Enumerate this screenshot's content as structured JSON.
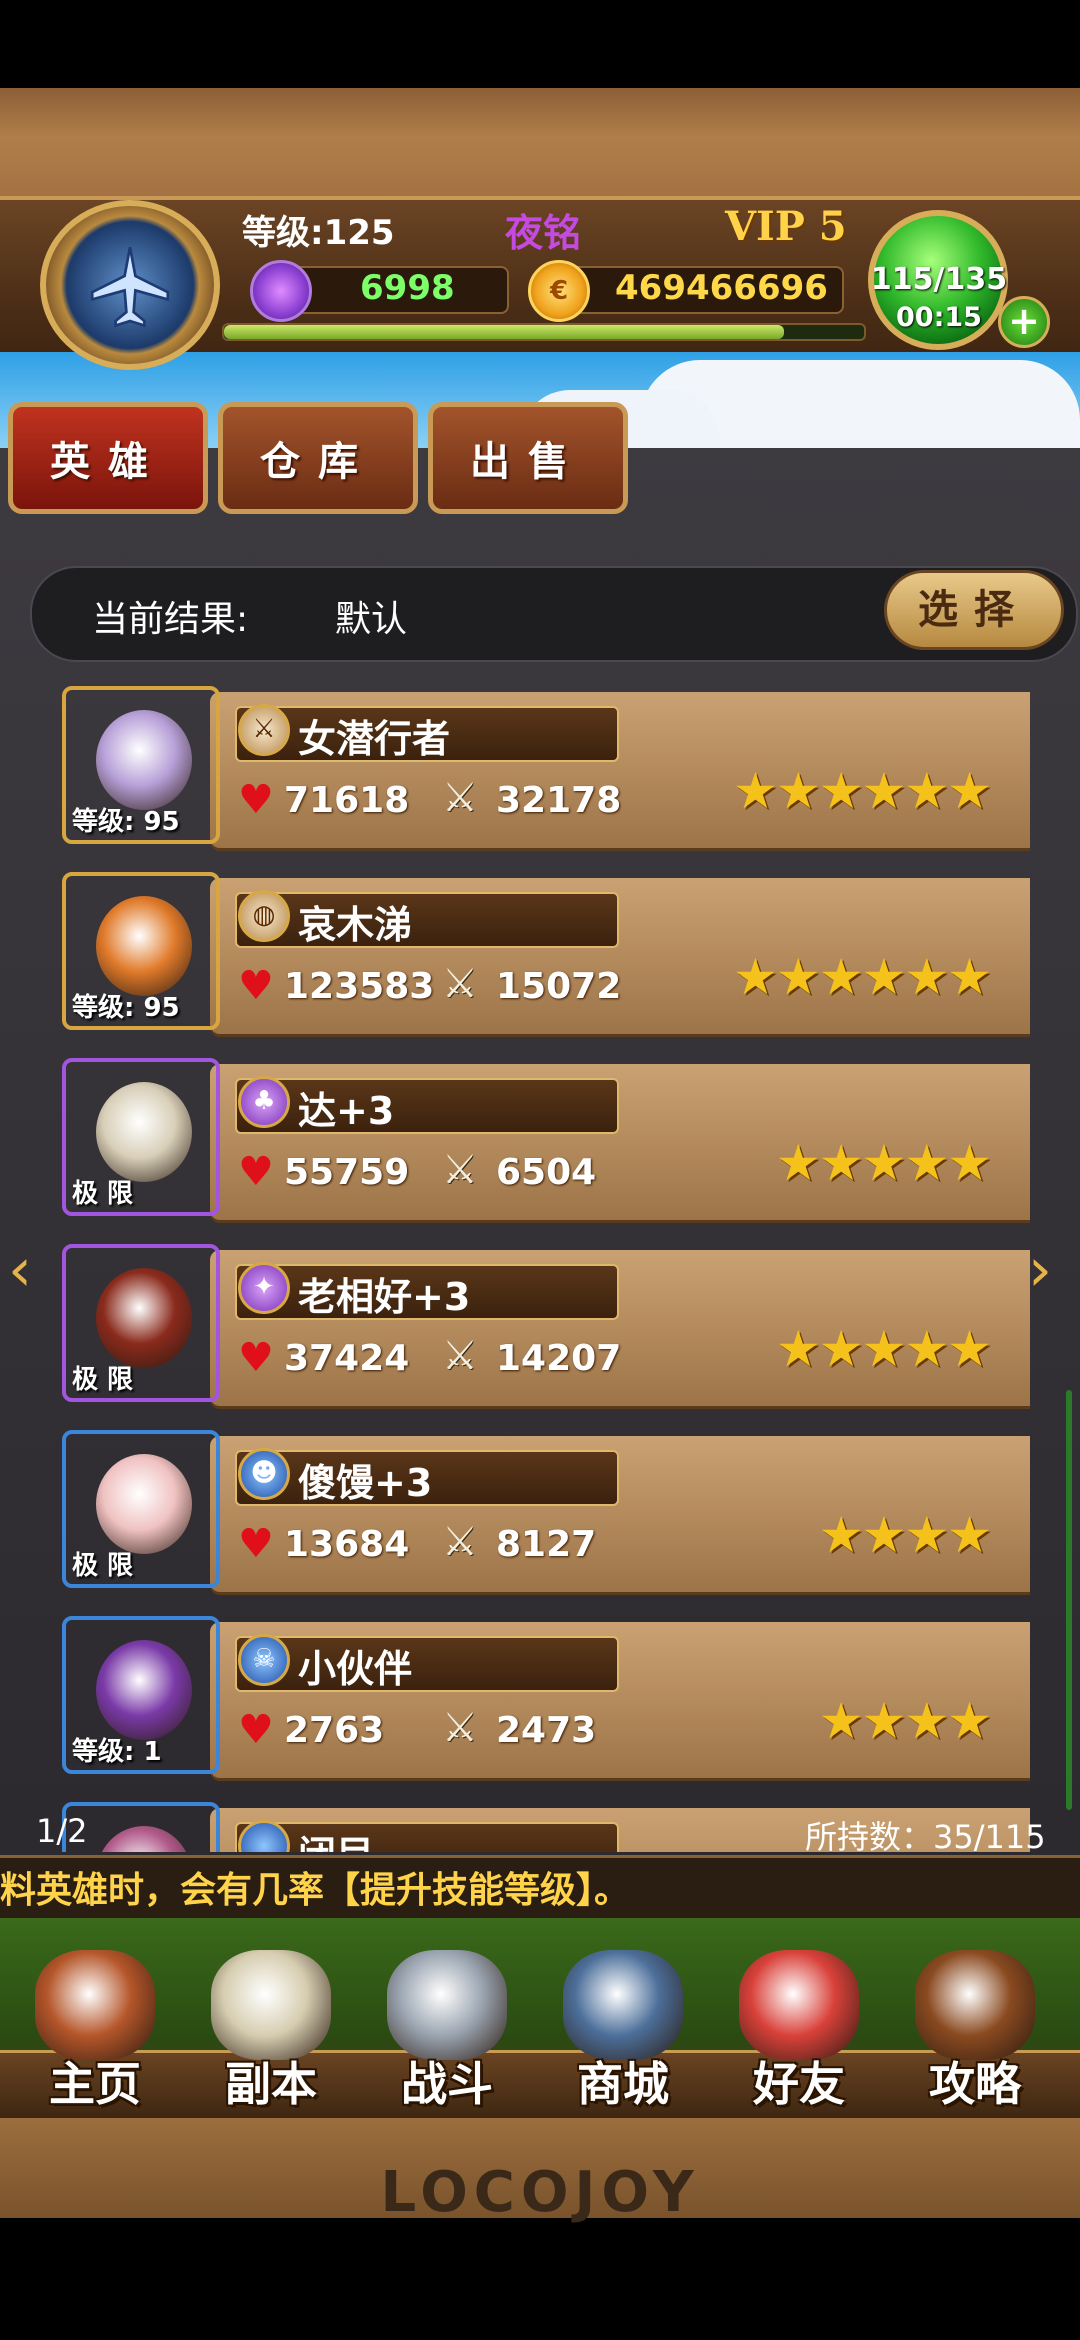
{
  "header": {
    "level_text": "等级:125",
    "player_name": "夜铭",
    "vip": "VIP 5",
    "gems": "6998",
    "gold": "469466696",
    "gold_icon_glyph": "€",
    "xp_progress": 0.88,
    "energy": "115/135",
    "energy_timer": "00:15",
    "energy_plus": "+"
  },
  "tabs": [
    {
      "label": "英雄",
      "active": true
    },
    {
      "label": "仓库",
      "active": false
    },
    {
      "label": "出售",
      "active": false
    }
  ],
  "filter": {
    "label": "当前结果:",
    "value": "默认",
    "select_label": "选择"
  },
  "heroes": [
    {
      "name": "女潜行者",
      "hp": "71618",
      "atk": "32178",
      "stars": "★★★★★★",
      "caption": "等级: 95",
      "frame": "gold",
      "class_icon": "sword-icon",
      "class_glyph": "⚔",
      "face_color": "#b7a0d8"
    },
    {
      "name": "哀木涕",
      "hp": "123583",
      "atk": "15072",
      "stars": "★★★★★★",
      "caption": "等级: 95",
      "frame": "gold",
      "class_icon": "shield-icon",
      "class_glyph": "◍",
      "face_color": "#e07a2a"
    },
    {
      "name": "达+3",
      "hp": "55759",
      "atk": "6504",
      "stars": "★★★★★",
      "caption": "极 限",
      "frame": "purple",
      "class_icon": "potion-icon",
      "class_glyph": "♣",
      "face_color": "#d8cfb8"
    },
    {
      "name": "老相好+3",
      "hp": "37424",
      "atk": "14207",
      "stars": "★★★★★",
      "caption": "极 限",
      "frame": "purple",
      "class_icon": "axe-icon",
      "class_glyph": "✦",
      "face_color": "#8a2a1c"
    },
    {
      "name": "傻馒+3",
      "hp": "13684",
      "atk": "8127",
      "stars": "★★★★",
      "caption": "极 限",
      "frame": "blue",
      "class_icon": "skull-icon",
      "class_glyph": "☻",
      "face_color": "#f0c2c2"
    },
    {
      "name": "小伙伴",
      "hp": "2763",
      "atk": "2473",
      "stars": "★★★★",
      "caption": "等级: 1",
      "frame": "blue",
      "class_icon": "skull-icon",
      "class_glyph": "☠",
      "face_color": "#7a3aa8"
    },
    {
      "name": "闭目",
      "hp": "",
      "atk": "",
      "stars": "",
      "caption": "",
      "frame": "blue",
      "class_icon": "skull-icon",
      "class_glyph": "",
      "face_color": "#b05a8a"
    }
  ],
  "icons": {
    "hp": "♥",
    "atk": "⚔",
    "arrow_left": "‹",
    "arrow_right": "›"
  },
  "page_indicator": "1/2",
  "owned_count": "所持数：35/115",
  "ticker": "料英雄时，会有几率【提升技能等级】。",
  "nav": [
    {
      "label": "主页",
      "icon": "home-icon",
      "color": "#b5562a"
    },
    {
      "label": "副本",
      "icon": "skull-dungeon-icon",
      "color": "#d6cdb0"
    },
    {
      "label": "战斗",
      "icon": "battle-icon",
      "color": "#9aa4b0"
    },
    {
      "label": "商城",
      "icon": "shop-icon",
      "color": "#4c6f9a"
    },
    {
      "label": "好友",
      "icon": "friends-icon",
      "color": "#d9413a"
    },
    {
      "label": "攻略",
      "icon": "guide-book-icon",
      "color": "#8a4a20"
    }
  ],
  "footer_logo": "LOCOJOY"
}
